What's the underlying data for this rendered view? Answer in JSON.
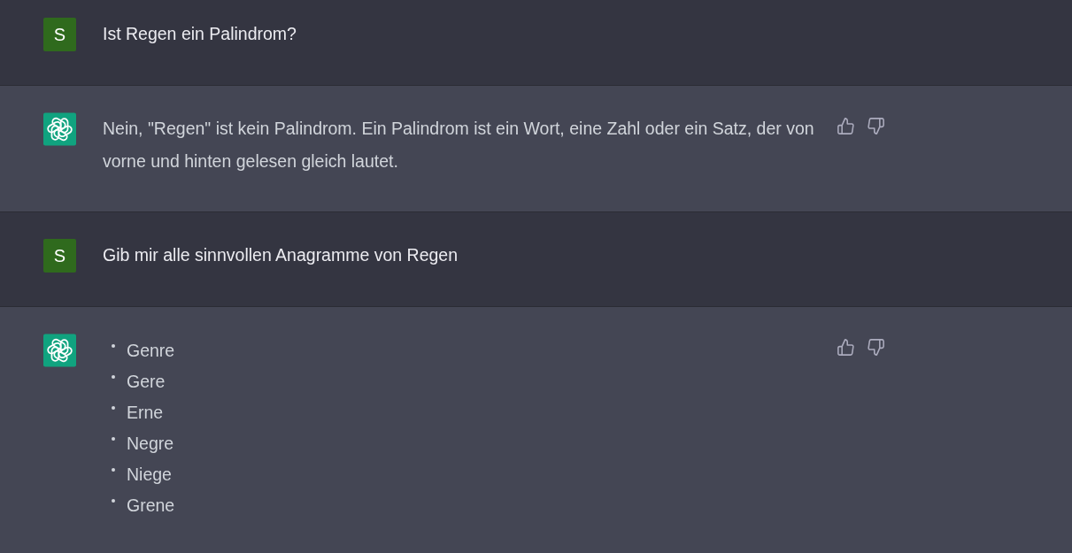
{
  "conversation": [
    {
      "kind": "user",
      "avatar": "S",
      "text": "Ist Regen ein Palindrom?"
    },
    {
      "kind": "assistant",
      "text": "Nein, \"Regen\" ist kein Palindrom. Ein Palindrom ist ein Wort, eine Zahl oder ein Satz, der von vorne und hinten gelesen gleich lautet."
    },
    {
      "kind": "user",
      "avatar": "S",
      "text": "Gib mir alle sinnvollen Anagramme von Regen"
    },
    {
      "kind": "assistant",
      "bullets": [
        "Genre",
        "Gere",
        "Erne",
        "Negre",
        "Niege",
        "Grene"
      ]
    }
  ]
}
